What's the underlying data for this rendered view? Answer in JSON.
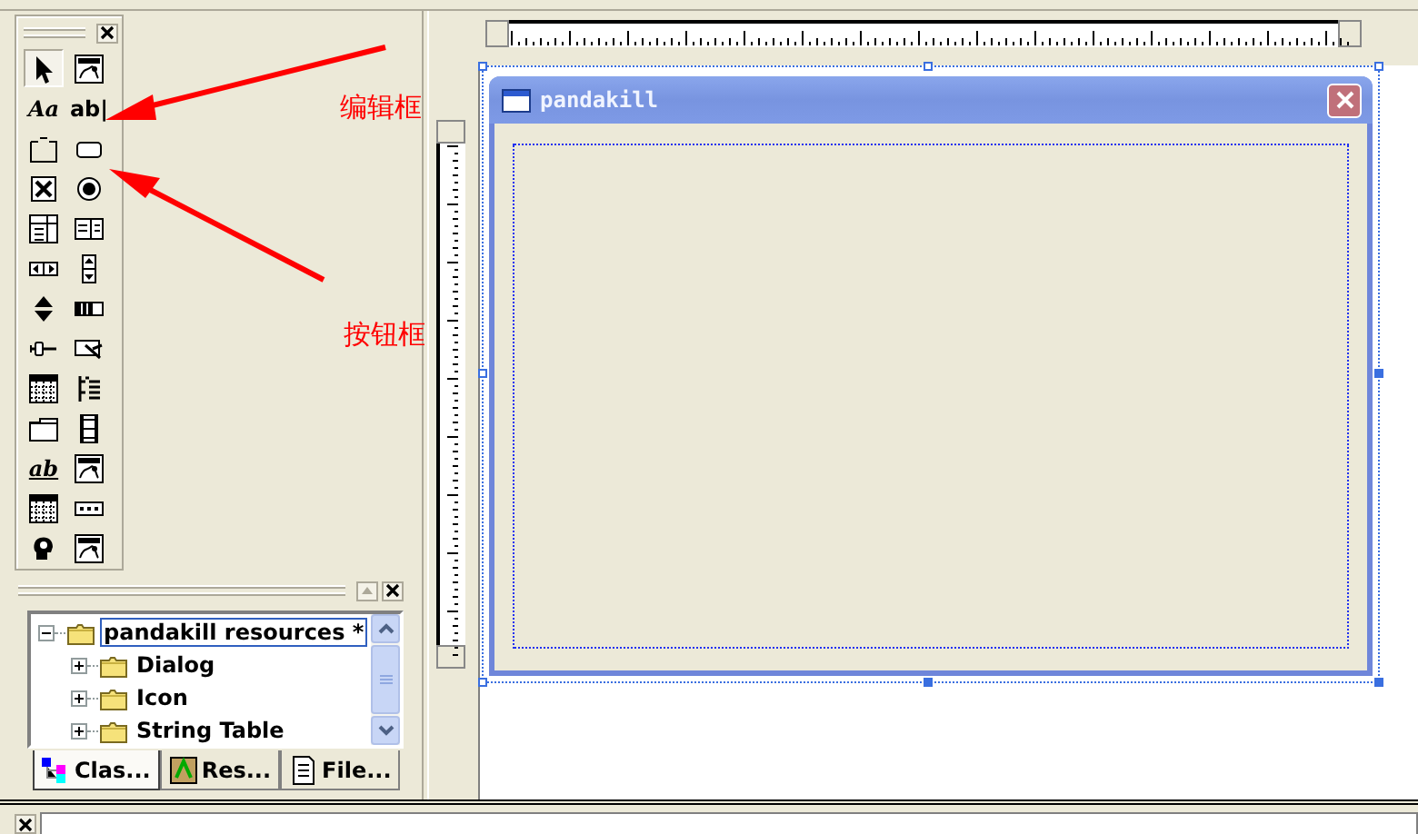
{
  "controls_toolbox": {
    "tools": [
      {
        "kind": "pointer",
        "selected": true
      },
      {
        "kind": "picture",
        "selected": false
      },
      {
        "kind": "text",
        "label": "Aa",
        "selected": false
      },
      {
        "kind": "text",
        "label": "ab|",
        "selected": false
      },
      {
        "kind": "group",
        "selected": false
      },
      {
        "kind": "button",
        "selected": false
      },
      {
        "kind": "checkbox",
        "selected": false
      },
      {
        "kind": "radio",
        "selected": false
      },
      {
        "kind": "combo",
        "selected": false
      },
      {
        "kind": "list",
        "selected": false
      },
      {
        "kind": "hscroll",
        "selected": false
      },
      {
        "kind": "vscroll",
        "selected": false
      },
      {
        "kind": "spin",
        "selected": false
      },
      {
        "kind": "progress",
        "selected": false
      },
      {
        "kind": "slider",
        "selected": false
      },
      {
        "kind": "hotkey",
        "selected": false
      },
      {
        "kind": "grid",
        "selected": false
      },
      {
        "kind": "tree",
        "selected": false
      },
      {
        "kind": "tab",
        "selected": false
      },
      {
        "kind": "film",
        "selected": false
      },
      {
        "kind": "text",
        "label": "ab",
        "selected": false
      },
      {
        "kind": "picture",
        "selected": false
      },
      {
        "kind": "grid",
        "selected": false
      },
      {
        "kind": "dots",
        "selected": false
      },
      {
        "kind": "head",
        "selected": false
      },
      {
        "kind": "picture",
        "selected": false
      }
    ]
  },
  "annotations": [
    {
      "text": "编辑框"
    },
    {
      "text": "按钮框"
    }
  ],
  "workspace": {
    "tree": [
      {
        "label": "pandakill resources *",
        "expanded": true,
        "selected": true,
        "children": [
          {
            "label": "Dialog",
            "expanded": false,
            "selected": false
          },
          {
            "label": "Icon",
            "expanded": false,
            "selected": false
          },
          {
            "label": "String Table",
            "expanded": false,
            "selected": false
          }
        ]
      }
    ],
    "tabs": [
      {
        "label": "Clas...",
        "kind": "classes",
        "selected": true
      },
      {
        "label": "Res...",
        "kind": "resources",
        "selected": false
      },
      {
        "label": "File...",
        "kind": "files",
        "selected": false
      }
    ]
  },
  "dialog": {
    "title": "pandakill"
  }
}
